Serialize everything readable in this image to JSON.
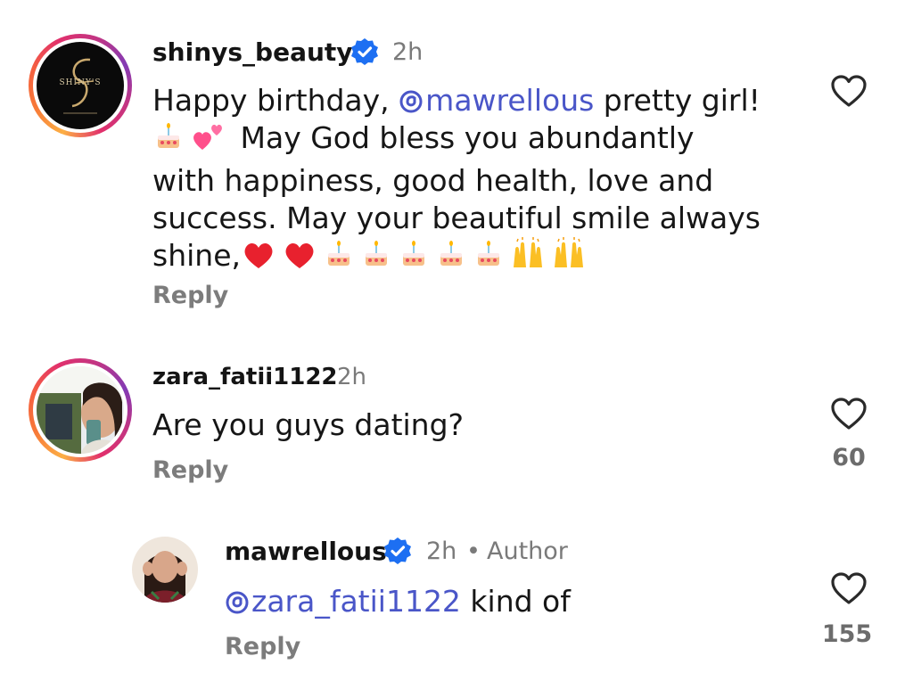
{
  "comments": [
    {
      "username": "shinys_beauty",
      "time": "2h",
      "avatar_logo_text": "SHINY'S",
      "text_segments": {
        "before_mention": "Happy birthday, ",
        "mention": "mawrellous",
        "after_mention": " pretty girl!",
        "line2": "May God bless you abundantly",
        "line3": "with happiness, good health, love and",
        "line4": "success. May your beautiful smile always",
        "line5": "shine,"
      },
      "reply_label": "Reply",
      "verified": true
    },
    {
      "username": "zara_fatii1122",
      "time": "2h",
      "text": "Are you guys dating?",
      "reply_label": "Reply",
      "like_count": "60"
    },
    {
      "username": "mawrellous",
      "time": "2h",
      "separator": "•",
      "author_label": "Author",
      "mention": "zara_fatii1122",
      "text": " kind of",
      "reply_label": "Reply",
      "like_count": "155",
      "verified": true
    }
  ],
  "colors": {
    "mention": "#4a56c8",
    "verified": "#1d6ff2",
    "secondary_text": "#7a7a7a"
  },
  "icons": [
    "heart-outline-icon",
    "verified-badge-icon",
    "threads-mention-icon",
    "birthday-cake-emoji",
    "two-hearts-emoji",
    "red-heart-emoji",
    "raising-hands-emoji"
  ]
}
